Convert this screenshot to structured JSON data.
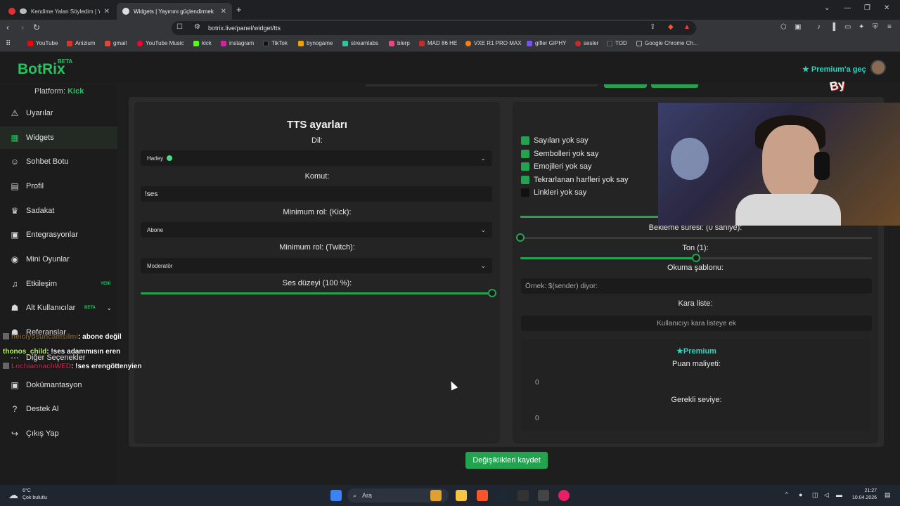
{
  "browser": {
    "tabs": [
      {
        "title": "Kendime Yalan Söyledim | YouTub",
        "color": "#e03131"
      },
      {
        "title": "Widgets | Yayınını güçlendirmek",
        "color": "#dddddd"
      }
    ],
    "new_tab_icon": "plus-icon",
    "url": "botrix.live/panel/widget/tts",
    "bookmarks": [
      {
        "label": "YouTube",
        "color": "#ff0000"
      },
      {
        "label": "Anizium",
        "color": "#e03131"
      },
      {
        "label": "gmail",
        "color": "#ea4335"
      },
      {
        "label": "YouTube Music",
        "color": "#ff0033"
      },
      {
        "label": "kick",
        "color": "#53fc18"
      },
      {
        "label": "instagram",
        "color": "#d6249f"
      },
      {
        "label": "TikTok",
        "color": "#111111"
      },
      {
        "label": "bynogame",
        "color": "#f59f00"
      },
      {
        "label": "streamlabs",
        "color": "#31c3a2"
      },
      {
        "label": "blerp",
        "color": "#e64980"
      },
      {
        "label": "MAD 86 HE",
        "color": "#c92a2a"
      },
      {
        "label": "VXE R1 PRO MAX",
        "color": "#fd7e14"
      },
      {
        "label": "gifler GIPHY",
        "color": "#7950f2"
      },
      {
        "label": "sesler",
        "color": "#c92a2a"
      },
      {
        "label": "TOD",
        "color": "#333333"
      },
      {
        "label": "Google Chrome Ch...",
        "color": "#888888"
      }
    ]
  },
  "app": {
    "logo": "BotRix",
    "beta": "BETA",
    "premium_cta": "Premium'a geç",
    "overlay_logo": "By"
  },
  "sidebar": {
    "platform_label": "Platform:",
    "platform_value": "Kick",
    "items": [
      {
        "label": "Uyarılar",
        "icon": "⚠"
      },
      {
        "label": "Widgets",
        "icon": "▦"
      },
      {
        "label": "Sohbet Botu",
        "icon": "☺"
      },
      {
        "label": "Profil",
        "icon": "▤"
      },
      {
        "label": "Sadakat",
        "icon": "♛"
      },
      {
        "label": "Entegrasyonlar",
        "icon": "▣"
      },
      {
        "label": "Mini Oyunlar",
        "icon": "◉"
      },
      {
        "label": "Etkileşim",
        "icon": "♫",
        "tag": "YENİ"
      },
      {
        "label": "Alt Kullanıcılar",
        "icon": "☗",
        "tag": "BETA"
      },
      {
        "label": "Referanslar",
        "icon": "☗"
      },
      {
        "label": "Diğer Seçenekler",
        "icon": "⋯"
      },
      {
        "label": "Dokümantasyon",
        "icon": "▣"
      },
      {
        "label": "Destek Al",
        "icon": "?"
      },
      {
        "label": "Çıkış Yap",
        "icon": "↪"
      }
    ]
  },
  "tts": {
    "title": "TTS ayarları",
    "lang_label": "Dil:",
    "lang_value": "Harley",
    "command_label": "Komut:",
    "command_value": "!ses",
    "min_role_kick_label": "Minimum rol: (Kick):",
    "min_role_kick_value": "Abone",
    "min_role_twitch_label": "Minimum rol: (Twitch):",
    "min_role_twitch_value": "Moderatör",
    "volume_label": "Ses düzeyi (100 %):",
    "volume": 1.0
  },
  "right": {
    "checkboxes": [
      {
        "label": "Sayıları yok say",
        "checked": true
      },
      {
        "label": "Sembolleri yok say",
        "checked": true
      },
      {
        "label": "Emojileri yok say",
        "checked": true
      },
      {
        "label": "Tekrarlanan harfleri yok say",
        "checked": true
      },
      {
        "label": "Linkleri yok say",
        "checked": false
      }
    ],
    "cooldown_label": "Bekleme süresi: (0 saniye):",
    "cooldown": 0.0,
    "pitch_label": "Ton (1):",
    "pitch": 0.5,
    "template_label": "Okuma şablonu:",
    "template_placeholder": "Örnek: $(sender) diyor:",
    "blacklist_label": "Kara liste:",
    "blacklist_placeholder": "Kullanıcıyı kara listeye ek",
    "premium_title": "Premium",
    "cost_label": "Puan maliyeti:",
    "cost_value": "0",
    "level_label": "Gerekli seviye:",
    "level_value": "0"
  },
  "save_label": "Değişiklikleri kaydet",
  "chat": [
    {
      "user": "neiciyosuncamsilmi",
      "msg": ": abone değil"
    },
    {
      "user": "thonos_child",
      "msg": ": !ses adammısın eren"
    },
    {
      "user": "LochiannachWED",
      "msg": ": !ses erengöttenyien"
    }
  ],
  "taskbar": {
    "temp": "6°C",
    "weather": "Çok bulutlu",
    "search_placeholder": "Ara",
    "time": "21:27",
    "date": "10.04.2026"
  }
}
